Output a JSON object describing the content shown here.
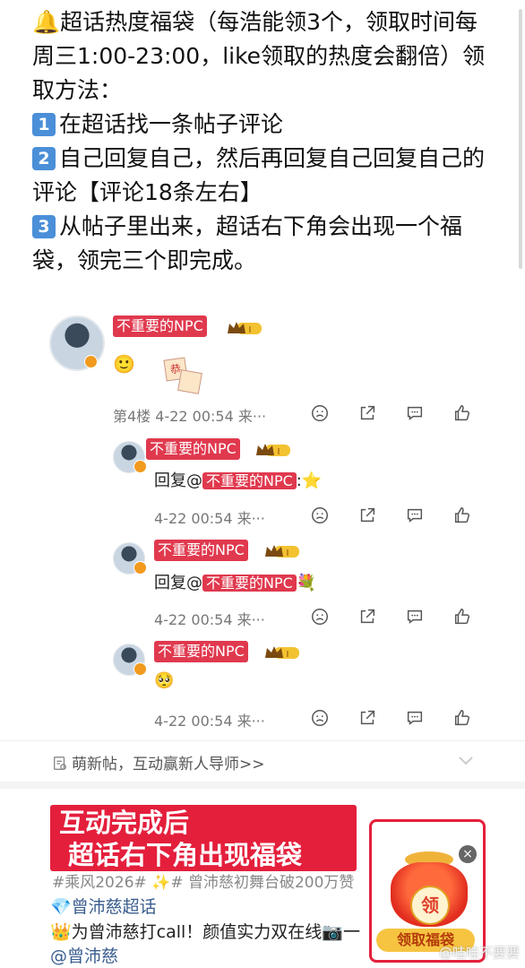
{
  "intro": {
    "line1": "🔔超话热度福袋（每浩能领3个，领取时间每周三1:00-23:00，like领取的热度会翻倍）领取方法：",
    "step1_num": "1",
    "step1": "在超话找一条帖子评论",
    "step2_num": "2",
    "step2": "自己回复自己，然后再回复自己回复自己的评论【评论18条左右】",
    "step3_num": "3",
    "step3": "从帖子里出来，超话右下角会出现一个福袋，领完三个即完成。"
  },
  "comment_main": {
    "username": "不重要的NPC",
    "level": "I",
    "emoji": "🙂",
    "sticker": "恭",
    "meta": "第4楼 4-22 00:54 来···"
  },
  "reply1": {
    "username": "不重要的NPC",
    "level": "I",
    "prefix": "回复@",
    "mention": "不重要的NPC",
    "suffix": ":⭐",
    "meta": "4-22 00:54 来···"
  },
  "reply2": {
    "username": "不重要的NPC",
    "level": "I",
    "prefix": "回复@",
    "mention": "不重要的NPC",
    "suffix": "💐",
    "meta": "4-22 00:54 来···"
  },
  "reply3": {
    "username": "不重要的NPC",
    "level": "I",
    "text": "🥺",
    "meta": "4-22 00:54 来···"
  },
  "topic": "萌新帖，互动赢新人导师>>",
  "banner": {
    "line1": "互动完成后",
    "line2": "超话右下角出现福袋"
  },
  "bottom": {
    "tags": "#乘风2026# ✨# 曾沛慈初舞台破200万赞",
    "supertopic": "💎曾沛慈超话",
    "cheer": "👑为曾沛慈打call！颜值实力双在线📷一",
    "mention": "@曾沛慈"
  },
  "reward": {
    "coin": "领",
    "button": "领取福袋",
    "close": "×"
  },
  "watermark": "@哇哇不要要",
  "colors": {
    "accent_red": "#e41f3c",
    "name_tag": "#e0394e",
    "step_blue": "#4a8fd8"
  }
}
